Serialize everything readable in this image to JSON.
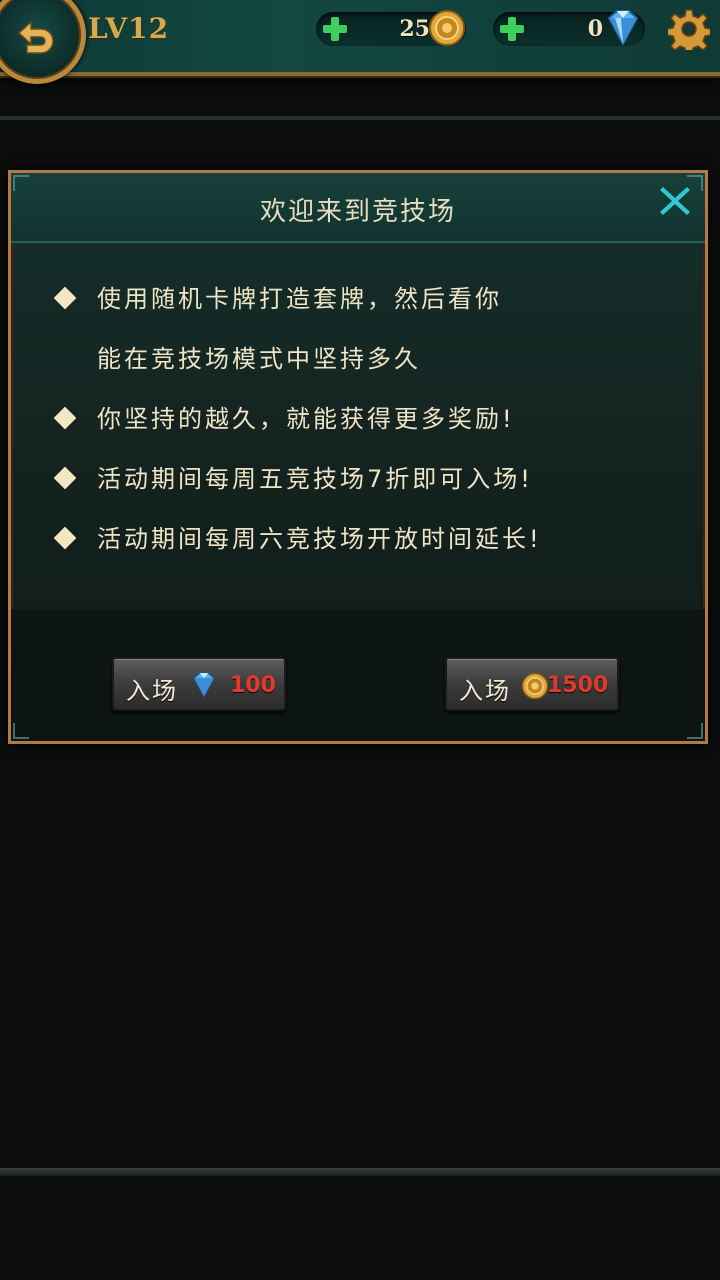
{
  "topbar": {
    "level": "LV12",
    "gold": "25",
    "gems": "0",
    "icons": {
      "back": "back-arrow-icon",
      "add": "plus-icon",
      "gold": "gold-coin-icon",
      "gem": "diamond-icon",
      "settings": "gear-icon"
    }
  },
  "dialog": {
    "title": "欢迎来到竞技场",
    "lines": [
      {
        "bullet": true,
        "text": "使用随机卡牌打造套牌，然后看你"
      },
      {
        "bullet": false,
        "text": "能在竞技场模式中坚持多久"
      },
      {
        "bullet": true,
        "text": "你坚持的越久，就能获得更多奖励!"
      },
      {
        "bullet": true,
        "text": "活动期间每周五竞技场7折即可入场!"
      },
      {
        "bullet": true,
        "text": "活动期间每周六竞技场开放时间延长!"
      }
    ],
    "buttons": {
      "gem_entry": {
        "label": "入场",
        "price": "100"
      },
      "gold_entry": {
        "label": "入场",
        "price": "1500"
      }
    }
  },
  "colors": {
    "accent_gold": "#d8a94a",
    "price_red": "#e23a2a",
    "close_cyan": "#2ec9d4"
  }
}
